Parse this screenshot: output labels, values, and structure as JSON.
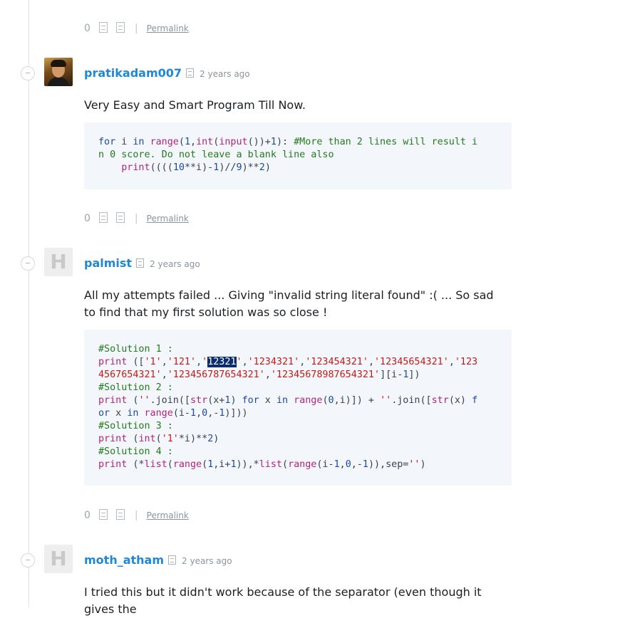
{
  "top_actions": {
    "votes": "0",
    "permalink": "Permalink"
  },
  "comments": [
    {
      "username": "pratikadam007",
      "time": "2 years ago",
      "text": "Very Easy and Smart Program Till Now.",
      "code_lines": [
        "for i in range(1,int(input())+1): #More than 2 lines will result i",
        "n 0 score. Do not leave a blank line also",
        "    print((((10**i)-1)//9)**2)"
      ],
      "votes": "0",
      "permalink": "Permalink"
    },
    {
      "username": "palmist",
      "time": "2 years ago",
      "text": "All my attempts failed ... Giving \"invalid string literal found\" :( ... So sad to find that my first solution was so close !",
      "code_lines": [
        "#Solution 1 :",
        "print (['1','121','12321','1234321','123454321','12345654321','123",
        "4567654321','123456787654321','12345678987654321'][i-1])",
        "#Solution 2 :",
        "print (''.join([str(x+1) for x in range(0,i)]) + ''.join([str(x) f",
        "or x in range(i-1,0,-1)]))",
        "#Solution 3 :",
        "print (int('1'*i)**2)",
        "#Solution 4 :",
        "print (*list(range(1,i+1)),*list(range(i-1,0,-1)),sep='')"
      ],
      "selected_text": "12321",
      "votes": "0",
      "permalink": "Permalink"
    },
    {
      "username": "moth_atham",
      "time": "2 years ago",
      "text": "I tried this but it didn't work because of the separator (even though it gives the"
    }
  ],
  "icons": {
    "collapse": "minus-circle-icon",
    "flag": "flag-icon",
    "upvote": "upvote-icon",
    "downvote": "downvote-icon",
    "avatar_placeholder": "hackerrank-h-icon"
  },
  "colors": {
    "username": "#1f87d8",
    "code_bg": "#f3f7fc",
    "selection": "#0b2d6b"
  }
}
